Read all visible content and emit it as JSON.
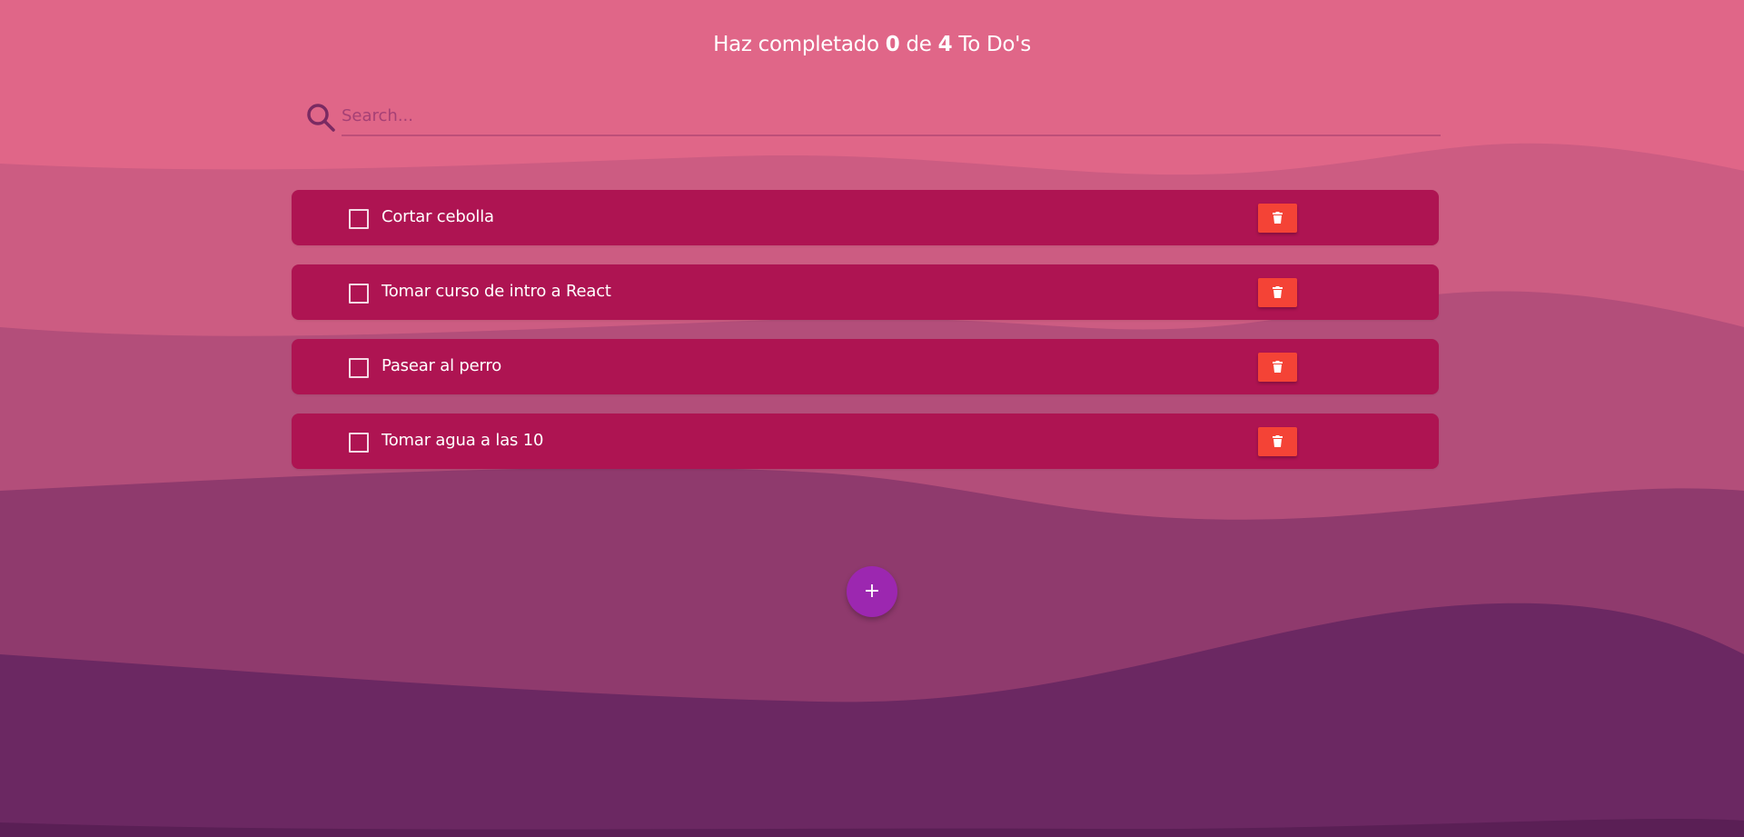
{
  "header": {
    "prefix": "Haz completado",
    "completed": "0",
    "middle": "de",
    "total": "4",
    "suffix": "To Do's"
  },
  "search": {
    "placeholder": "Search...",
    "value": "",
    "icon": "search-icon"
  },
  "todos": [
    {
      "text": "Cortar cebolla",
      "completed": false
    },
    {
      "text": "Tomar curso de intro a React",
      "completed": false
    },
    {
      "text": "Pasear al perro",
      "completed": false
    },
    {
      "text": "Tomar agua a las 10",
      "completed": false
    }
  ],
  "delete_icon": "trash-icon",
  "add_button": {
    "label": "+"
  },
  "colors": {
    "background_top": "#e06688",
    "todo_item": "#ae1452",
    "delete_button": "#f44336",
    "add_button": "#9c27b0",
    "wave_dark": "#6b2862"
  }
}
